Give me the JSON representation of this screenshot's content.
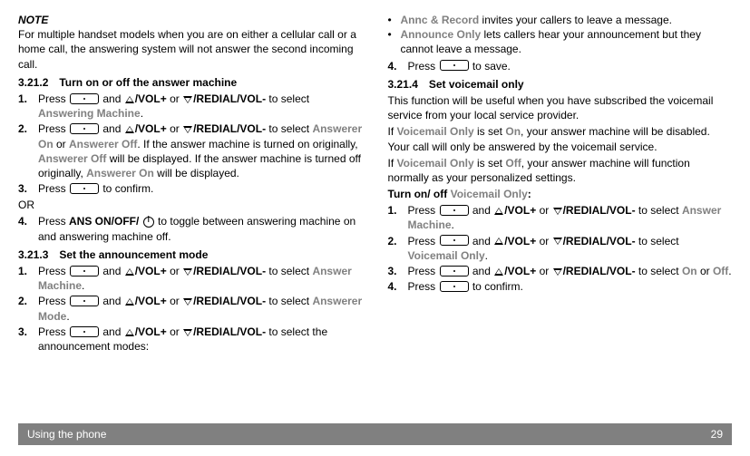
{
  "footer": {
    "title": "Using the phone",
    "page": "29"
  },
  "left": {
    "note_label": "NOTE",
    "note_body": "For multiple handset models when you are on either a cellular call or a home call, the answering system will not answer the second incoming call.",
    "s3212": {
      "head": "3.21.2 Turn on or off the answer machine",
      "step1_a": "Press ",
      "step1_b": " and ",
      "step1_c": "/VOL+",
      "step1_d": " or ",
      "step1_e": "/REDIAL/VOL-",
      "step1_f": " to select ",
      "step1_g": "Answering Machine",
      "step1_h": ".",
      "step2_a": "Press ",
      "step2_b": " and ",
      "step2_c": "/VOL+",
      "step2_d": " or ",
      "step2_e": "/REDIAL/VOL-",
      "step2_f": " to select ",
      "step2_g": "Answerer On",
      "step2_h": " or ",
      "step2_i": "Answerer Off",
      "step2_j": ". If the answer machine is turned on originally, ",
      "step2_k": "Answerer Off",
      "step2_l": " will be displayed. If the answer machine is turned off originally, ",
      "step2_m": "Answerer On",
      "step2_n": " will be displayed.",
      "step3_a": "Press ",
      "step3_b": " to confirm.",
      "or": "OR",
      "step4_a": "Press ",
      "step4_b": "ANS ON/OFF/ ",
      "step4_c": " to toggle between answering machine on and answering machine off."
    },
    "s3213": {
      "head": "3.21.3 Set the announcement mode",
      "step1_a": "Press ",
      "step1_b": " and ",
      "step1_c": "/VOL+",
      "step1_d": " or ",
      "step1_e": "/REDIAL/VOL-",
      "step1_f": " to select ",
      "step1_g": "Answer Machine",
      "step1_h": ".",
      "step2_a": "Press ",
      "step2_b": " and ",
      "step2_c": "/VOL+",
      "step2_d": " or ",
      "step2_e": "/REDIAL/VOL-",
      "step2_f": " to select ",
      "step2_g": "Answerer Mode",
      "step2_h": ".",
      "step3_a": "Press ",
      "step3_b": " and ",
      "step3_c": "/VOL+",
      "step3_d": " or ",
      "step3_e": "/REDIAL/VOL-",
      "step3_f": " to select the announcement modes:"
    }
  },
  "right": {
    "bul1_a": "Annc & Record",
    "bul1_b": " invites your callers to leave a message.",
    "bul2_a": "Announce Only",
    "bul2_b": " lets callers hear your announcement but they cannot leave a message.",
    "step4_a": "Press ",
    "step4_b": " to save.",
    "s3214": {
      "head": "3.21.4 Set voicemail only",
      "intro": "This function will be useful when you have subscribed the voicemail service from your local service provider.",
      "p2_a": "If ",
      "p2_b": "Voicemail Only",
      "p2_c": " is set ",
      "p2_d": "On",
      "p2_e": ", your answer machine will be disabled. Your call will only be answered by the voicemail service.",
      "p3_a": "If ",
      "p3_b": "Voicemail Only",
      "p3_c": " is set ",
      "p3_d": "Off",
      "p3_e": ", your answer machine will function normally as your personalized settings.",
      "turn_a": "Turn on/ off ",
      "turn_b": "Voicemail Only",
      "turn_c": ":",
      "st1_a": "Press ",
      "st1_b": " and ",
      "st1_c": "/VOL+",
      "st1_d": " or ",
      "st1_e": "/REDIAL/VOL-",
      "st1_f": " to select ",
      "st1_g": "Answer Machine",
      "st1_h": ".",
      "st2_a": "Press ",
      "st2_b": " and ",
      "st2_c": "/VOL+",
      "st2_d": " or ",
      "st2_e": "/REDIAL/VOL-",
      "st2_f": " to select ",
      "st2_g": "Voicemail Only",
      "st2_h": ".",
      "st3_a": "Press ",
      "st3_b": " and ",
      "st3_c": "/VOL+",
      "st3_d": " or ",
      "st3_e": "/REDIAL/VOL-",
      "st3_f": " to select ",
      "st3_g": "On",
      "st3_h": " or ",
      "st3_i": "Off",
      "st3_j": ".",
      "st4_a": "Press ",
      "st4_b": " to confirm."
    }
  }
}
